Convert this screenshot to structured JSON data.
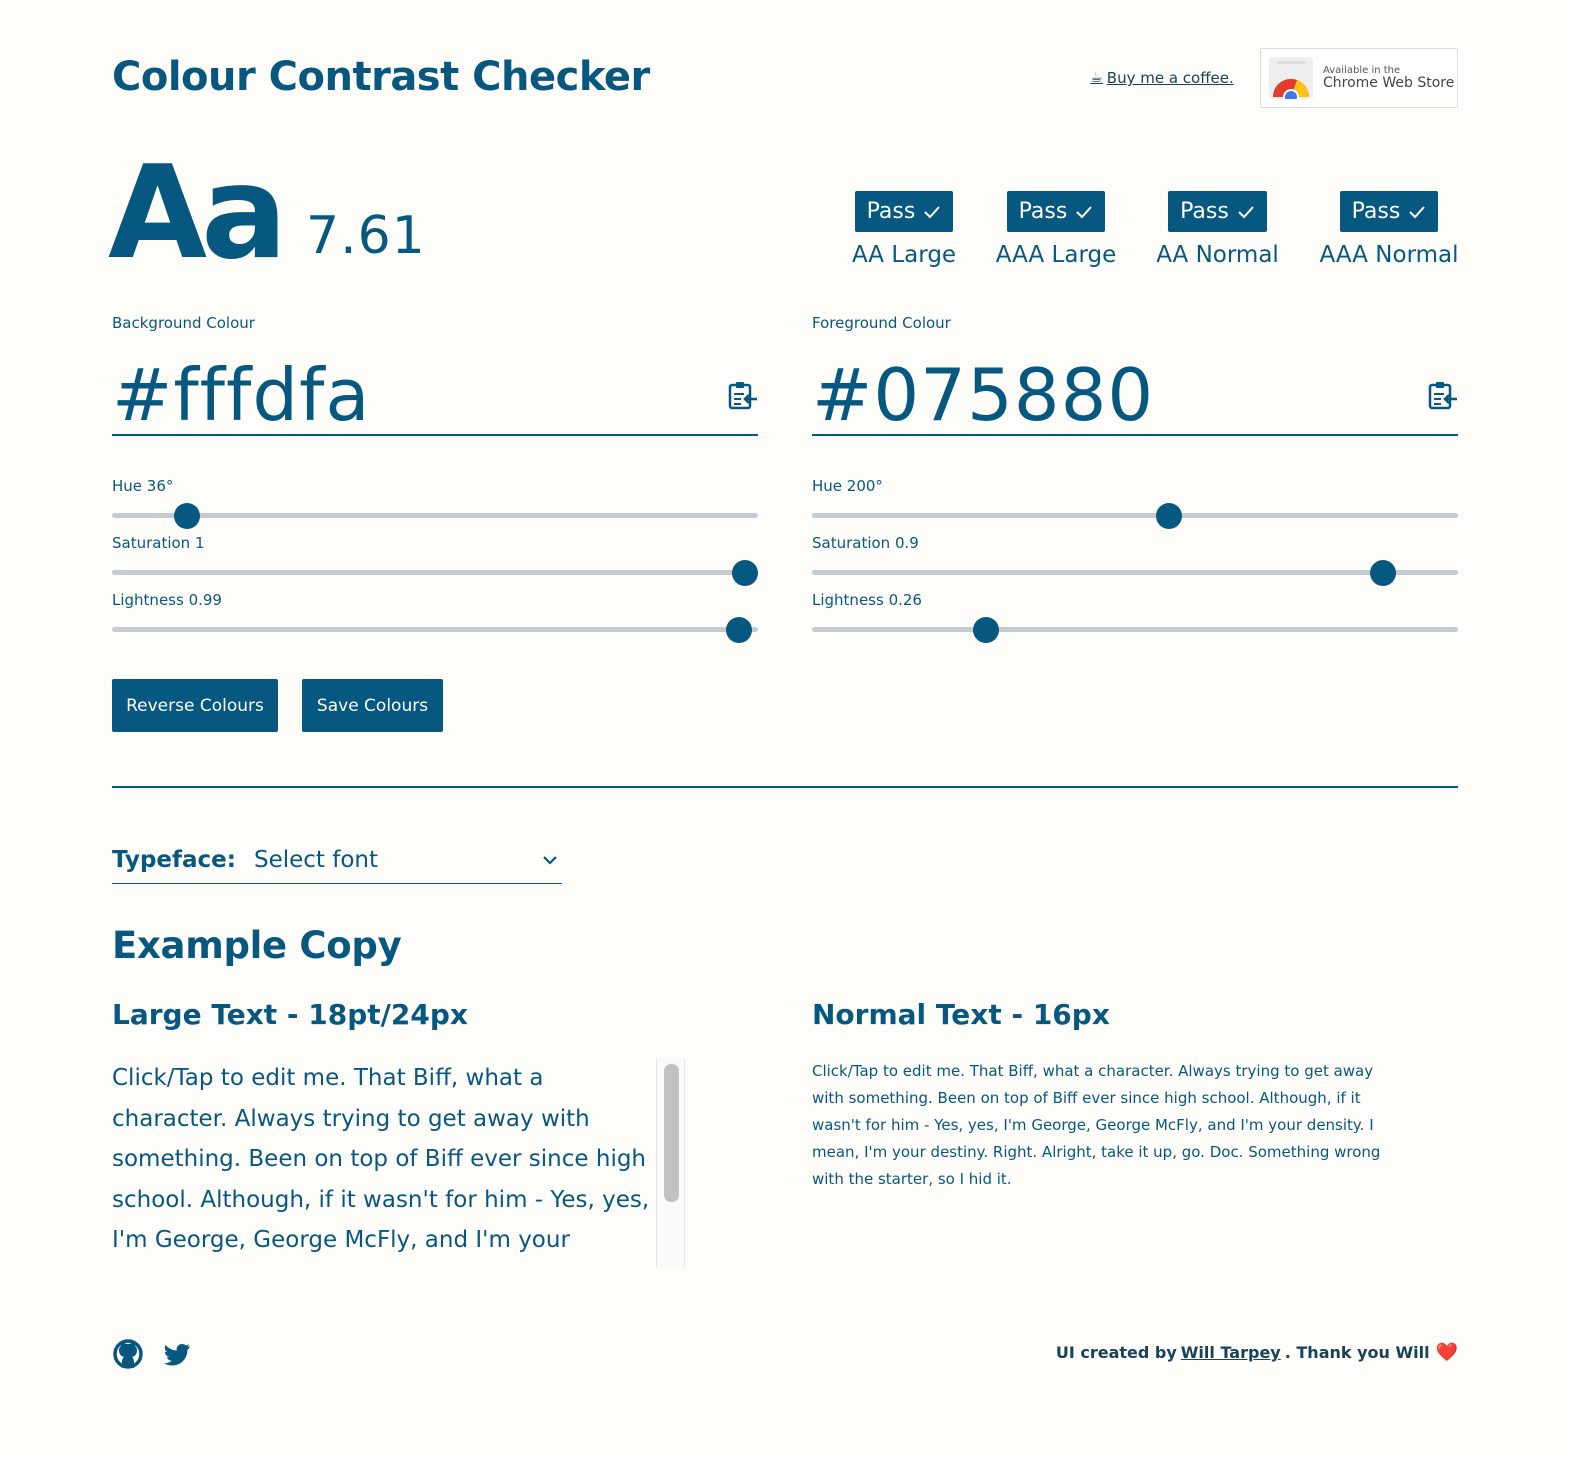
{
  "header": {
    "title": "Colour Contrast Checker",
    "coffee_icon": "☕",
    "coffee_link": "Buy me a coffee.",
    "store_small": "Available in the",
    "store_big": "Chrome Web Store"
  },
  "sample": {
    "aa": "Aa",
    "ratio": "7.61"
  },
  "results": [
    {
      "status": "Pass",
      "label": "AA Large"
    },
    {
      "status": "Pass",
      "label": "AAA Large"
    },
    {
      "status": "Pass",
      "label": "AA Normal"
    },
    {
      "status": "Pass",
      "label": "AAA Normal"
    }
  ],
  "background": {
    "label": "Background Colour",
    "hex": "#fffdfa",
    "hue_label": "Hue 36°",
    "saturation_label": "Saturation 1",
    "lightness_label": "Lightness 0.99",
    "hue": 36,
    "saturation": 1,
    "lightness": 0.99
  },
  "foreground": {
    "label": "Foreground Colour",
    "hex": "#075880",
    "hue_label": "Hue 200°",
    "saturation_label": "Saturation 0.9",
    "lightness_label": "Lightness 0.26",
    "hue": 200,
    "saturation": 0.9,
    "lightness": 0.26
  },
  "buttons": {
    "reverse": "Reverse Colours",
    "save": "Save Colours"
  },
  "typeface": {
    "label": "Typeface:",
    "placeholder": "Select font"
  },
  "example": {
    "heading": "Example Copy",
    "large_heading": "Large Text - 18pt/24px",
    "normal_heading": "Normal Text - 16px",
    "large_text": "Click/Tap to edit me. That Biff, what a character. Always trying to get away with something. Been on top of Biff ever since high school. Although, if it wasn't for him - Yes, yes, I'm George, George McFly, and I'm your density. I mean, I'm your destiny. Right. Alright, take it up, go. Doc. Something wrong with the starter, so I hid it.",
    "normal_text": "Click/Tap to edit me. That Biff, what a character. Always trying to get away with something. Been on top of Biff ever since high school. Although, if it wasn't for him - Yes, yes, I'm George, George McFly, and I'm your density. I mean, I'm your destiny. Right. Alright, take it up, go. Doc. Something wrong with the starter, so I hid it."
  },
  "footer": {
    "credit_prefix": "UI created by",
    "credit_name": "Will Tarpey",
    "credit_suffix": ". Thank you Will",
    "heart": "❤️"
  },
  "colors": {
    "foreground": "#075880",
    "background": "#fffdfa",
    "track": "#c3ccd3"
  }
}
